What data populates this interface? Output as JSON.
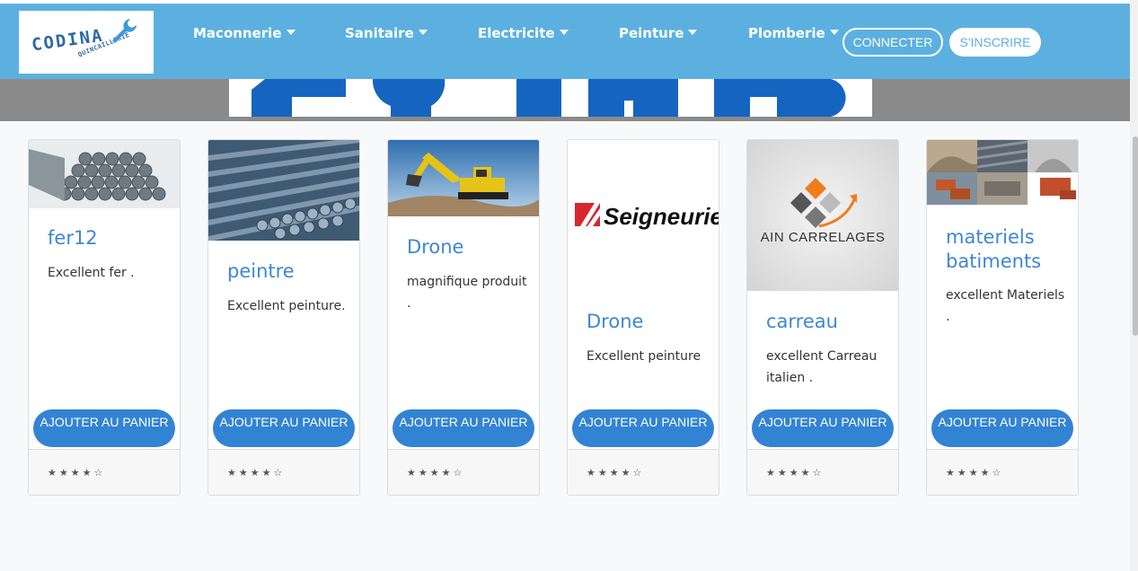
{
  "brand": {
    "logo_text": "CODINA",
    "logo_sub": "QUINCAILLERIE"
  },
  "nav": {
    "items": [
      {
        "label": "Maconnerie"
      },
      {
        "label": "Sanitaire"
      },
      {
        "label": "Electricite"
      },
      {
        "label": "Peinture"
      },
      {
        "label": "Plomberie"
      }
    ],
    "connect_label": "CONNECTER",
    "signup_label": "S'INSCRIRE"
  },
  "colors": {
    "navbar": "#5cb0e0",
    "accent": "#3d87d4",
    "button": "#3283d4"
  },
  "products": [
    {
      "title": "fer12",
      "desc": "Excellent fer .",
      "button": "AJOUTER AU PANIER",
      "stars": "★★★★☆",
      "image": "rebar-bundle-image"
    },
    {
      "title": "peintre",
      "desc": "Excellent peinture.",
      "button": "AJOUTER AU PANIER",
      "stars": "★★★★☆",
      "image": "steel-bars-image"
    },
    {
      "title": "Drone",
      "desc": "magnifique produit .",
      "button": "AJOUTER AU PANIER",
      "stars": "★★★★☆",
      "image": "excavator-image"
    },
    {
      "title": "Drone",
      "desc": "Excellent peinture",
      "button": "AJOUTER AU PANIER",
      "stars": "★★★★☆",
      "image": "seigneurie-logo",
      "logo_text": "Seigneurie"
    },
    {
      "title": "carreau",
      "desc": "excellent Carreau italien .",
      "button": "AJOUTER AU PANIER",
      "stars": "★★★★☆",
      "image": "ain-carrelages-logo",
      "logo_text": "AIN CARRELAGES"
    },
    {
      "title": "materiels batiments",
      "desc": "excellent Materiels .",
      "button": "AJOUTER AU PANIER",
      "stars": "★★★★☆",
      "image": "materials-collage-image"
    }
  ]
}
